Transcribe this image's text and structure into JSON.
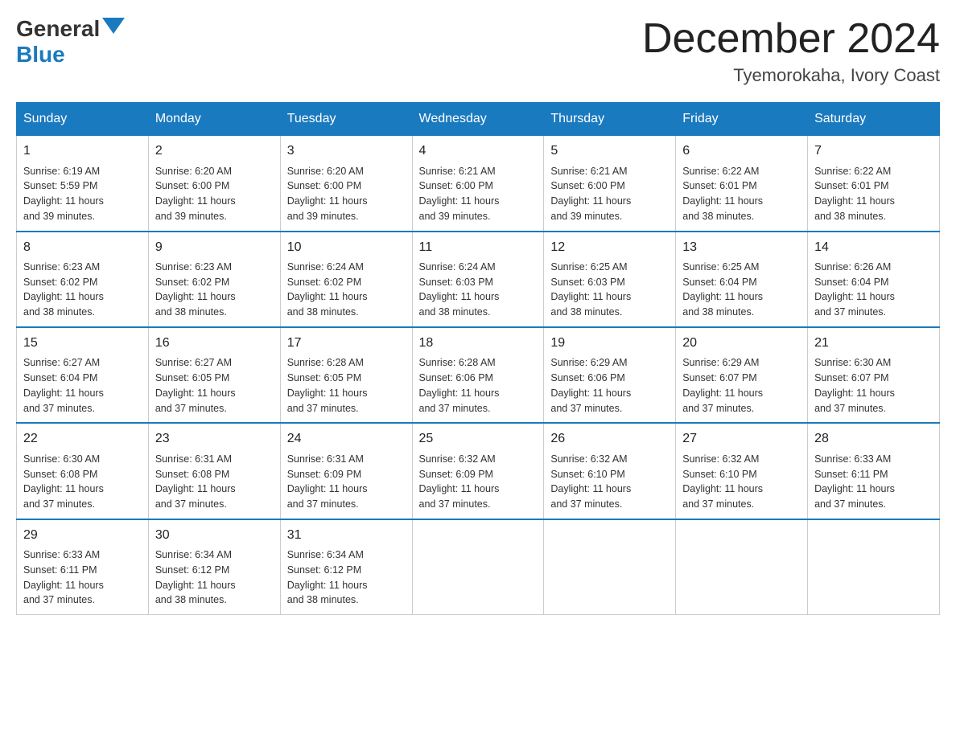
{
  "logo": {
    "general": "General",
    "blue": "Blue"
  },
  "header": {
    "month_title": "December 2024",
    "location": "Tyemorokaha, Ivory Coast"
  },
  "weekdays": [
    "Sunday",
    "Monday",
    "Tuesday",
    "Wednesday",
    "Thursday",
    "Friday",
    "Saturday"
  ],
  "weeks": [
    [
      {
        "day": "1",
        "sunrise": "6:19 AM",
        "sunset": "5:59 PM",
        "daylight": "11 hours and 39 minutes."
      },
      {
        "day": "2",
        "sunrise": "6:20 AM",
        "sunset": "6:00 PM",
        "daylight": "11 hours and 39 minutes."
      },
      {
        "day": "3",
        "sunrise": "6:20 AM",
        "sunset": "6:00 PM",
        "daylight": "11 hours and 39 minutes."
      },
      {
        "day": "4",
        "sunrise": "6:21 AM",
        "sunset": "6:00 PM",
        "daylight": "11 hours and 39 minutes."
      },
      {
        "day": "5",
        "sunrise": "6:21 AM",
        "sunset": "6:00 PM",
        "daylight": "11 hours and 39 minutes."
      },
      {
        "day": "6",
        "sunrise": "6:22 AM",
        "sunset": "6:01 PM",
        "daylight": "11 hours and 38 minutes."
      },
      {
        "day": "7",
        "sunrise": "6:22 AM",
        "sunset": "6:01 PM",
        "daylight": "11 hours and 38 minutes."
      }
    ],
    [
      {
        "day": "8",
        "sunrise": "6:23 AM",
        "sunset": "6:02 PM",
        "daylight": "11 hours and 38 minutes."
      },
      {
        "day": "9",
        "sunrise": "6:23 AM",
        "sunset": "6:02 PM",
        "daylight": "11 hours and 38 minutes."
      },
      {
        "day": "10",
        "sunrise": "6:24 AM",
        "sunset": "6:02 PM",
        "daylight": "11 hours and 38 minutes."
      },
      {
        "day": "11",
        "sunrise": "6:24 AM",
        "sunset": "6:03 PM",
        "daylight": "11 hours and 38 minutes."
      },
      {
        "day": "12",
        "sunrise": "6:25 AM",
        "sunset": "6:03 PM",
        "daylight": "11 hours and 38 minutes."
      },
      {
        "day": "13",
        "sunrise": "6:25 AM",
        "sunset": "6:04 PM",
        "daylight": "11 hours and 38 minutes."
      },
      {
        "day": "14",
        "sunrise": "6:26 AM",
        "sunset": "6:04 PM",
        "daylight": "11 hours and 37 minutes."
      }
    ],
    [
      {
        "day": "15",
        "sunrise": "6:27 AM",
        "sunset": "6:04 PM",
        "daylight": "11 hours and 37 minutes."
      },
      {
        "day": "16",
        "sunrise": "6:27 AM",
        "sunset": "6:05 PM",
        "daylight": "11 hours and 37 minutes."
      },
      {
        "day": "17",
        "sunrise": "6:28 AM",
        "sunset": "6:05 PM",
        "daylight": "11 hours and 37 minutes."
      },
      {
        "day": "18",
        "sunrise": "6:28 AM",
        "sunset": "6:06 PM",
        "daylight": "11 hours and 37 minutes."
      },
      {
        "day": "19",
        "sunrise": "6:29 AM",
        "sunset": "6:06 PM",
        "daylight": "11 hours and 37 minutes."
      },
      {
        "day": "20",
        "sunrise": "6:29 AM",
        "sunset": "6:07 PM",
        "daylight": "11 hours and 37 minutes."
      },
      {
        "day": "21",
        "sunrise": "6:30 AM",
        "sunset": "6:07 PM",
        "daylight": "11 hours and 37 minutes."
      }
    ],
    [
      {
        "day": "22",
        "sunrise": "6:30 AM",
        "sunset": "6:08 PM",
        "daylight": "11 hours and 37 minutes."
      },
      {
        "day": "23",
        "sunrise": "6:31 AM",
        "sunset": "6:08 PM",
        "daylight": "11 hours and 37 minutes."
      },
      {
        "day": "24",
        "sunrise": "6:31 AM",
        "sunset": "6:09 PM",
        "daylight": "11 hours and 37 minutes."
      },
      {
        "day": "25",
        "sunrise": "6:32 AM",
        "sunset": "6:09 PM",
        "daylight": "11 hours and 37 minutes."
      },
      {
        "day": "26",
        "sunrise": "6:32 AM",
        "sunset": "6:10 PM",
        "daylight": "11 hours and 37 minutes."
      },
      {
        "day": "27",
        "sunrise": "6:32 AM",
        "sunset": "6:10 PM",
        "daylight": "11 hours and 37 minutes."
      },
      {
        "day": "28",
        "sunrise": "6:33 AM",
        "sunset": "6:11 PM",
        "daylight": "11 hours and 37 minutes."
      }
    ],
    [
      {
        "day": "29",
        "sunrise": "6:33 AM",
        "sunset": "6:11 PM",
        "daylight": "11 hours and 37 minutes."
      },
      {
        "day": "30",
        "sunrise": "6:34 AM",
        "sunset": "6:12 PM",
        "daylight": "11 hours and 38 minutes."
      },
      {
        "day": "31",
        "sunrise": "6:34 AM",
        "sunset": "6:12 PM",
        "daylight": "11 hours and 38 minutes."
      },
      null,
      null,
      null,
      null
    ]
  ],
  "labels": {
    "sunrise": "Sunrise:",
    "sunset": "Sunset:",
    "daylight": "Daylight:"
  }
}
